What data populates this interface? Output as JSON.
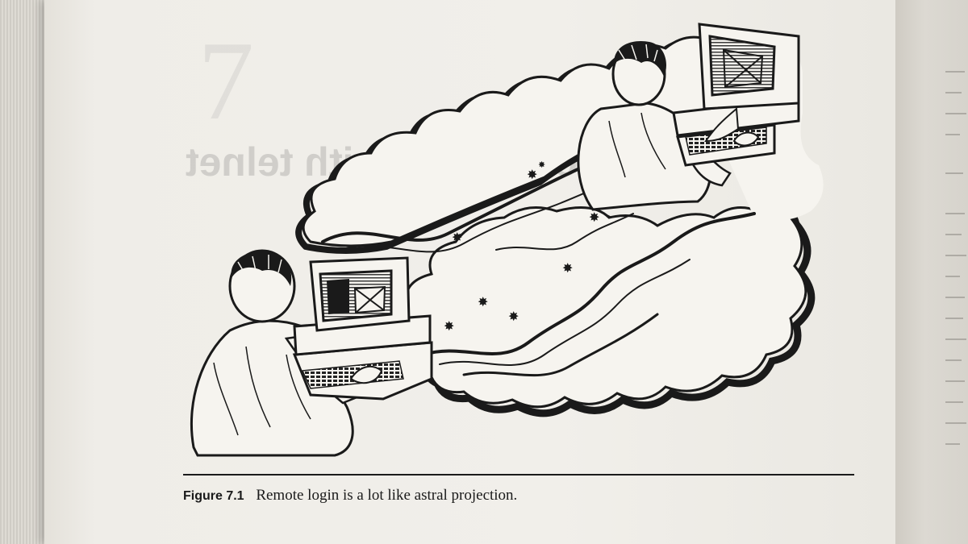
{
  "figure": {
    "label": "Figure 7.1",
    "caption": "Remote login is a lot like astral projection."
  },
  "ghost_text": {
    "chapter_number": "7",
    "chapter_title": "Remote Login with telnet"
  },
  "colors": {
    "page": "#f1efea",
    "ink": "#1a1a1a",
    "rule": "#1b1b1b"
  }
}
